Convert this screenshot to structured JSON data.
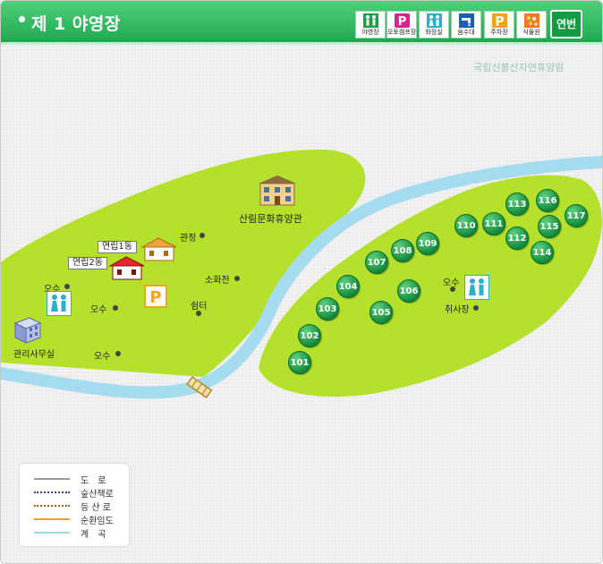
{
  "header": {
    "title": "제 1 야영장",
    "buttons": [
      {
        "label": "야영장",
        "icon": "campers-icon"
      },
      {
        "label": "오토캠프장",
        "icon": "auto-camp-icon"
      },
      {
        "label": "화장실",
        "icon": "restroom-icon"
      },
      {
        "label": "음수대",
        "icon": "drinking-water-icon"
      },
      {
        "label": "주차장",
        "icon": "parking-icon"
      },
      {
        "label": "식물원",
        "icon": "botanical-garden-icon"
      }
    ],
    "year_button": "연번"
  },
  "map": {
    "park_name": "국립신불산자연휴양림",
    "labels": {
      "lodge": "산림문화휴양관",
      "pavilion": "관정",
      "hydrant": "소화전",
      "shelter": "쉼터",
      "sewage1": "오수",
      "sewage2": "오수",
      "sewage3": "오수",
      "sewage4": "오수",
      "office": "관리사무실",
      "cooking": "취사장",
      "building1": "연립1동",
      "building2": "연립2동"
    },
    "sites": [
      "101",
      "102",
      "103",
      "104",
      "105",
      "106",
      "107",
      "108",
      "109",
      "110",
      "111",
      "112",
      "113",
      "114",
      "115",
      "116",
      "117"
    ]
  },
  "legend": {
    "items": [
      {
        "label": "도　로",
        "color": "#9a9a9a"
      },
      {
        "label": "숲산책로",
        "color": "#2a47a8"
      },
      {
        "label": "등 산 로",
        "color": "#a0661a"
      },
      {
        "label": "순환임도",
        "color": "#f39a26"
      },
      {
        "label": "계　곡",
        "color": "#9fd6ee"
      }
    ]
  },
  "colors": {
    "header": "#2dba5e",
    "land": "#b5e02c",
    "stream": "#a6dcef",
    "site": "#1c9a45"
  }
}
